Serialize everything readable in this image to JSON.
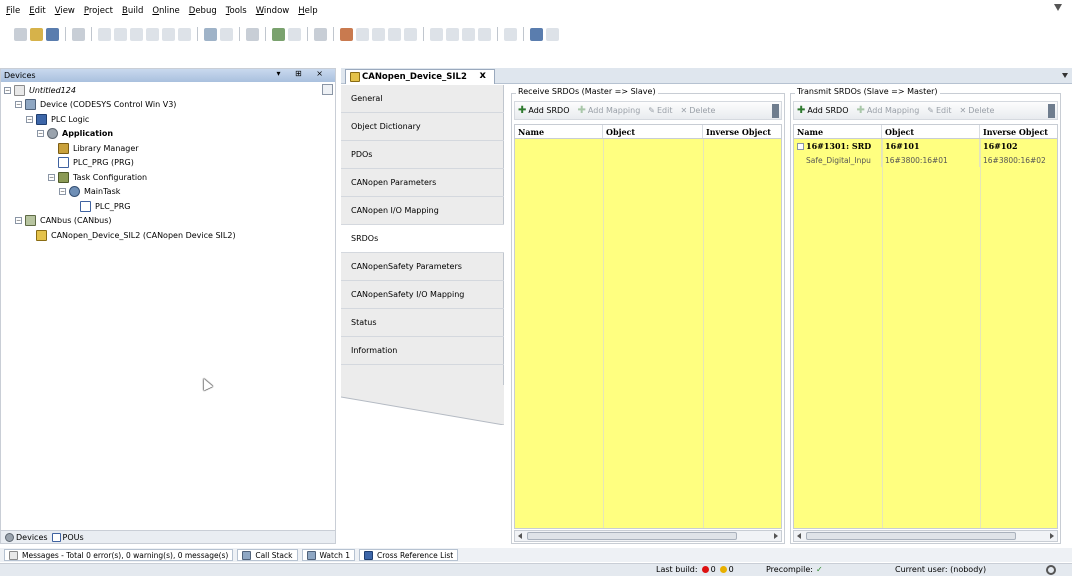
{
  "menu": [
    "File",
    "Edit",
    "View",
    "Project",
    "Build",
    "Online",
    "Debug",
    "Tools",
    "Window",
    "Help"
  ],
  "devices_panel": {
    "title": "Devices",
    "controls": "▾ ⊞ ×",
    "tree": [
      {
        "label": "Untitled124",
        "level": 0,
        "icon": "project-icon",
        "expander": "−",
        "italic": true
      },
      {
        "label": "Device (CODESYS Control Win V3)",
        "level": 1,
        "icon": "device-icon",
        "expander": "−"
      },
      {
        "label": "PLC Logic",
        "level": 2,
        "icon": "plc-logic-icon",
        "expander": "−"
      },
      {
        "label": "Application",
        "level": 3,
        "icon": "application-icon",
        "expander": "−",
        "bold": true
      },
      {
        "label": "Library Manager",
        "level": 4,
        "icon": "library-manager-icon",
        "expander": ""
      },
      {
        "label": "PLC_PRG (PRG)",
        "level": 4,
        "icon": "pou-icon",
        "expander": ""
      },
      {
        "label": "Task Configuration",
        "level": 4,
        "icon": "task-configuration-icon",
        "expander": "−"
      },
      {
        "label": "MainTask",
        "level": 5,
        "icon": "main-task-icon",
        "expander": "−"
      },
      {
        "label": "PLC_PRG",
        "level": 6,
        "icon": "pou-call-icon",
        "expander": ""
      },
      {
        "label": "CANbus (CANbus)",
        "level": 1,
        "icon": "canbus-icon",
        "expander": "−"
      },
      {
        "label": "CANopen_Device_SIL2 (CANopen Device SIL2)",
        "level": 2,
        "icon": "canopen-device-icon",
        "expander": ""
      }
    ],
    "bottom_tabs": [
      "Devices",
      "POUs"
    ]
  },
  "editor": {
    "tab_title": "CANopen_Device_SIL2",
    "tab_close": "x",
    "nav_items": [
      "General",
      "Object Dictionary",
      "PDOs",
      "CANopen Parameters",
      "CANopen I/O Mapping",
      "SRDOs",
      "CANopenSafety Parameters",
      "CANopenSafety I/O Mapping",
      "Status",
      "Information"
    ],
    "active_nav_index": 5,
    "receive": {
      "title": "Receive SRDOs (Master => Slave)",
      "tools": {
        "add_srdo": "Add SRDO",
        "add_mapping": "Add Mapping",
        "edit": "Edit",
        "delete": "Delete"
      },
      "columns": [
        "Name",
        "Object",
        "Inverse Object"
      ],
      "rows": []
    },
    "transmit": {
      "title": "Transmit SRDOs (Slave => Master)",
      "tools": {
        "add_srdo": "Add SRDO",
        "add_mapping": "Add Mapping",
        "edit": "Edit",
        "delete": "Delete"
      },
      "columns": [
        "Name",
        "Object",
        "Inverse Object"
      ],
      "rows": [
        {
          "name": "16#1301: SRD",
          "object": "16#101",
          "inverse": "16#102"
        },
        {
          "name": "Safe_Digital_Inpu",
          "object": "16#3800:16#01",
          "inverse": "16#3800:16#02"
        }
      ]
    },
    "grid_color": "#ffff80"
  },
  "messages": {
    "messages_tab": "Messages - Total 0 error(s), 0 warning(s), 0 message(s)",
    "call_stack": "Call Stack",
    "watch": "Watch 1",
    "cross_ref": "Cross Reference List"
  },
  "status": {
    "last_build_label": "Last build:",
    "errors": "0",
    "warnings": "0",
    "precompile_label": "Precompile:",
    "precompile_ok": "✓",
    "user": "Current user: (nobody)"
  }
}
